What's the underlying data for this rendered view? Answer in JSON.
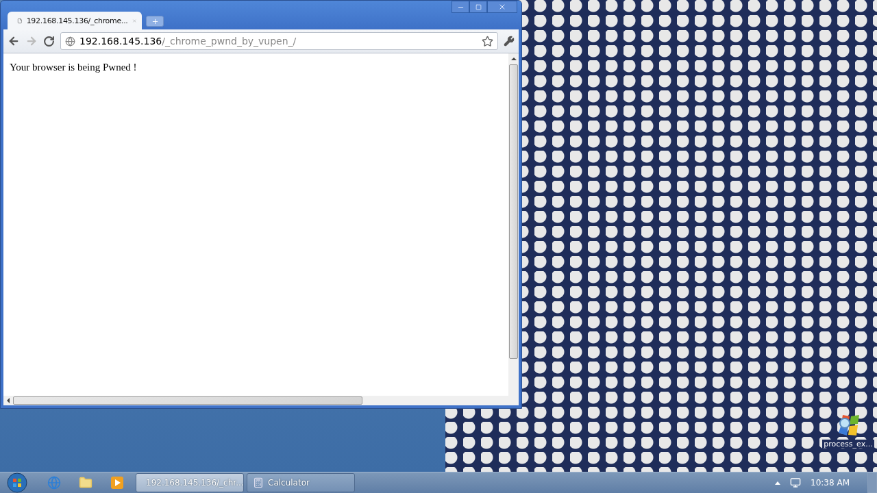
{
  "browser": {
    "tab": {
      "title": "192.168.145.136/_chrome...",
      "selected": true
    },
    "address": {
      "host": "192.168.145.136",
      "path": "/_chrome_pwnd_by_vupen_/"
    },
    "page_text": "Your browser is being Pwned !"
  },
  "desktop_icons": [
    {
      "label": "process_ex..."
    }
  ],
  "taskbar": {
    "tasks": [
      {
        "label": "192.168.145.136/_chr...",
        "kind": "chrome",
        "selected": true
      },
      {
        "label": "Calculator",
        "kind": "calculator",
        "selected": false
      }
    ],
    "clock": "10:38 AM"
  }
}
